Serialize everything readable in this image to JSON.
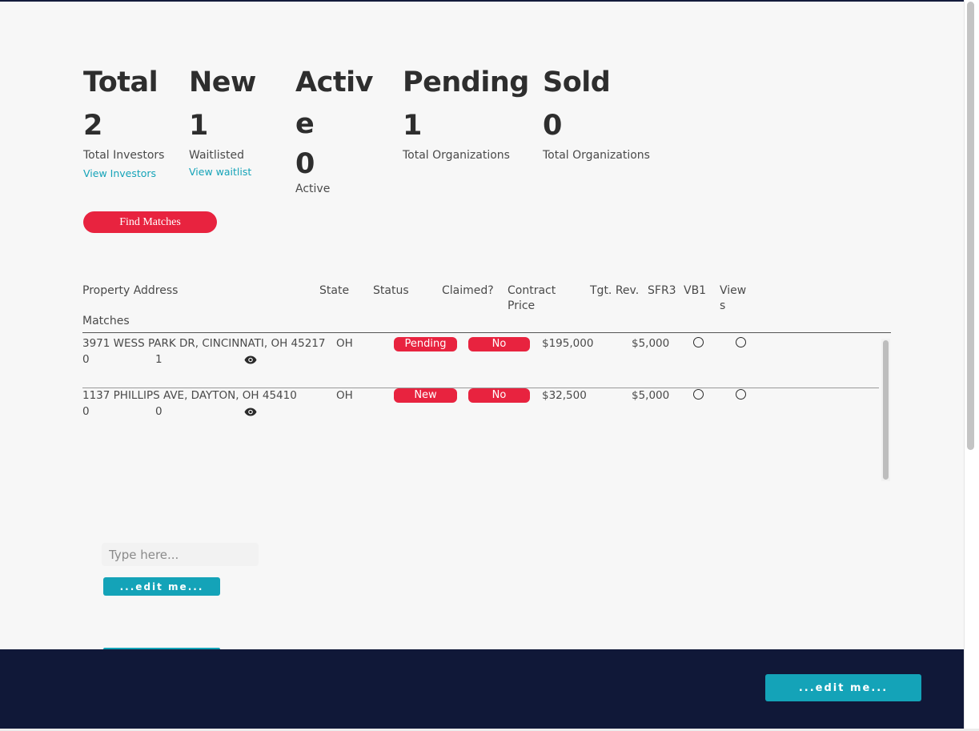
{
  "stats": [
    {
      "title": "Total",
      "value": "2",
      "sub": "Total Investors",
      "link": "View Investors"
    },
    {
      "title": "New",
      "value": "1",
      "sub": "Waitlisted",
      "link": "View waitlist"
    },
    {
      "title": "Activ",
      "title2": "e",
      "value": "0",
      "sub": "Active"
    },
    {
      "title": "Pending",
      "value": "1",
      "sub": "Total Organizations"
    },
    {
      "title": "Sold",
      "value": "0",
      "sub": "Total Organizations"
    }
  ],
  "find_button": "Find Matches",
  "table": {
    "headers": {
      "address": "Property Address",
      "state": "State",
      "status": "Status",
      "claimed": "Claimed?",
      "contract_1": "Contract",
      "contract_2": "Price",
      "tgt_rev": "Tgt. Rev.",
      "sfr3": "SFR3",
      "vb1": "VB1",
      "views_1": "View",
      "views_2": "s",
      "matches": "Matches"
    },
    "rows": [
      {
        "address": "3971 WESS PARK DR, CINCINNATI, OH 45217",
        "matches": "0",
        "views": "1",
        "state": "OH",
        "status": "Pending",
        "claimed": "No",
        "contract_price": "$195,000",
        "tgt_rev": "$5,000"
      },
      {
        "address": "1137 PHILLIPS AVE, DAYTON, OH 45410",
        "matches": "0",
        "views": "0",
        "state": "OH",
        "status": "New",
        "claimed": "No",
        "contract_price": "$32,500",
        "tgt_rev": "$5,000"
      }
    ]
  },
  "input": {
    "placeholder": "Type here..."
  },
  "edit_button_1": "...edit me...",
  "edit_button_2": "...edit me...",
  "colors": {
    "accent_red": "#e8233f",
    "teal": "#14a3b8",
    "navy": "#101838"
  }
}
